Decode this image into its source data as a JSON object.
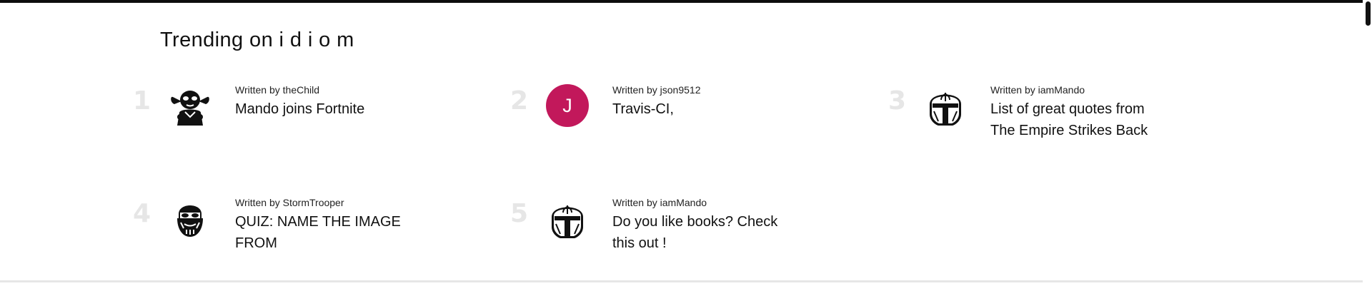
{
  "trending": {
    "title": "Trending on i d i o m",
    "written_by_prefix": "Written by",
    "items": [
      {
        "rank": "1",
        "author": "theChild",
        "headline": "Mando joins Fortnite",
        "avatar": "baby-yoda-icon"
      },
      {
        "rank": "2",
        "author": "json9512",
        "headline": "Travis-CI,",
        "avatar": "letter-avatar",
        "avatar_letter": "J",
        "avatar_color": "#c2185b"
      },
      {
        "rank": "3",
        "author": "iamMando",
        "headline": "List of great quotes from The Empire Strikes Back",
        "avatar": "mandalorian-helmet-icon"
      },
      {
        "rank": "4",
        "author": "StormTrooper",
        "headline": "QUIZ: NAME THE IMAGE FROM",
        "avatar": "stormtrooper-helmet-icon"
      },
      {
        "rank": "5",
        "author": "iamMando",
        "headline": "Do you like books? Check this out !",
        "avatar": "mandalorian-helmet-icon"
      }
    ]
  },
  "colors": {
    "rank_number": "#e6e6e6",
    "avatar_j": "#c2185b",
    "text": "#111111"
  }
}
